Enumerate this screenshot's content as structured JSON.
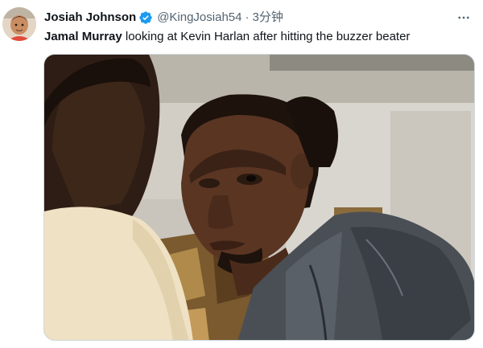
{
  "author": {
    "display_name": "Josiah Johnson",
    "handle": "@KingJosiah54",
    "separator": "·",
    "timestamp": "3分钟",
    "verified_icon": "verified-badge-icon",
    "avatar_icon": "child-avatar"
  },
  "menu": {
    "icon": "more-horizontal-icon"
  },
  "tweet": {
    "mention": "Jamal Murray",
    "text": " looking at Kevin Harlan after hitting the buzzer beater"
  },
  "media": {
    "description_icon": "meme-photo"
  },
  "colors": {
    "verified": "#1d9bf0",
    "secondary_text": "#536471",
    "primary_text": "#0f1419",
    "border": "#cfd9de"
  }
}
